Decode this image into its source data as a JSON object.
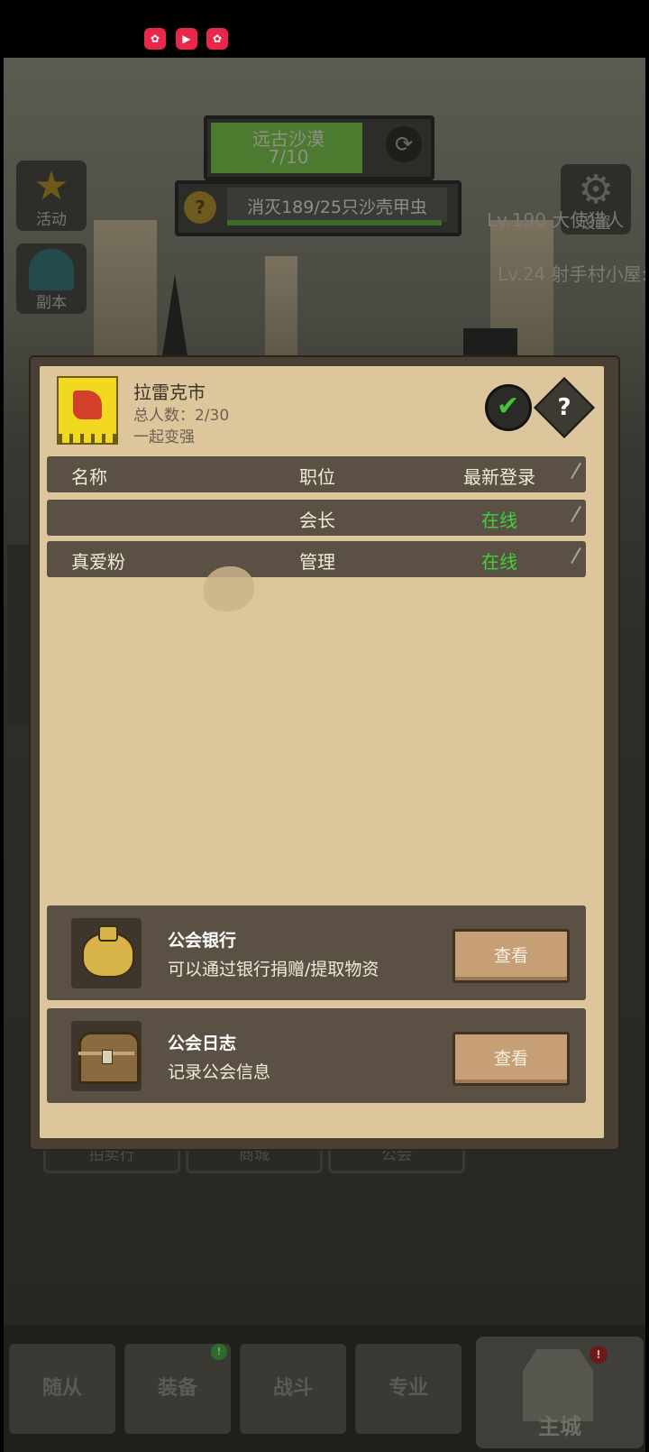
{
  "status_bar": {
    "icons": [
      "kuaishou-app-icon",
      "video-app-icon",
      "kuaishou-app-icon"
    ]
  },
  "hud": {
    "quest_title": "远古沙漠",
    "quest_progress": "7/10",
    "task_text": "消灭189/25只沙壳甲虫",
    "left_buttons": [
      "活动",
      "副本"
    ],
    "settings_label": "设置",
    "right_lines": [
      "Lv.190 大使猎人",
      "Lv.24 射手村小屋:"
    ]
  },
  "behind_tabs": [
    "拍卖行",
    "商城",
    "公会"
  ],
  "bottom_nav": {
    "tabs": [
      "随从",
      "装备",
      "战斗",
      "专业"
    ],
    "home_label": "主城",
    "equip_badge": "!",
    "home_badge": "!"
  },
  "guild": {
    "name": "拉雷克市",
    "member_count": "总人数：2/30",
    "slogan": "一起变强",
    "table": {
      "headers": [
        "名称",
        "职位",
        "最新登录"
      ],
      "rows": [
        {
          "name": "",
          "role": "会长",
          "status": "在线"
        },
        {
          "name": "真爱粉",
          "role": "管理",
          "status": "在线"
        }
      ]
    },
    "bank": {
      "title": "公会银行",
      "desc": "可以通过银行捐赠/提取物资",
      "button": "查看"
    },
    "log": {
      "title": "公会日志",
      "desc": "记录公会信息",
      "button": "查看"
    }
  },
  "colors": {
    "online": "#3ed33a",
    "dialog_bg": "#ddc59c",
    "row_bg": "#5a5144"
  }
}
